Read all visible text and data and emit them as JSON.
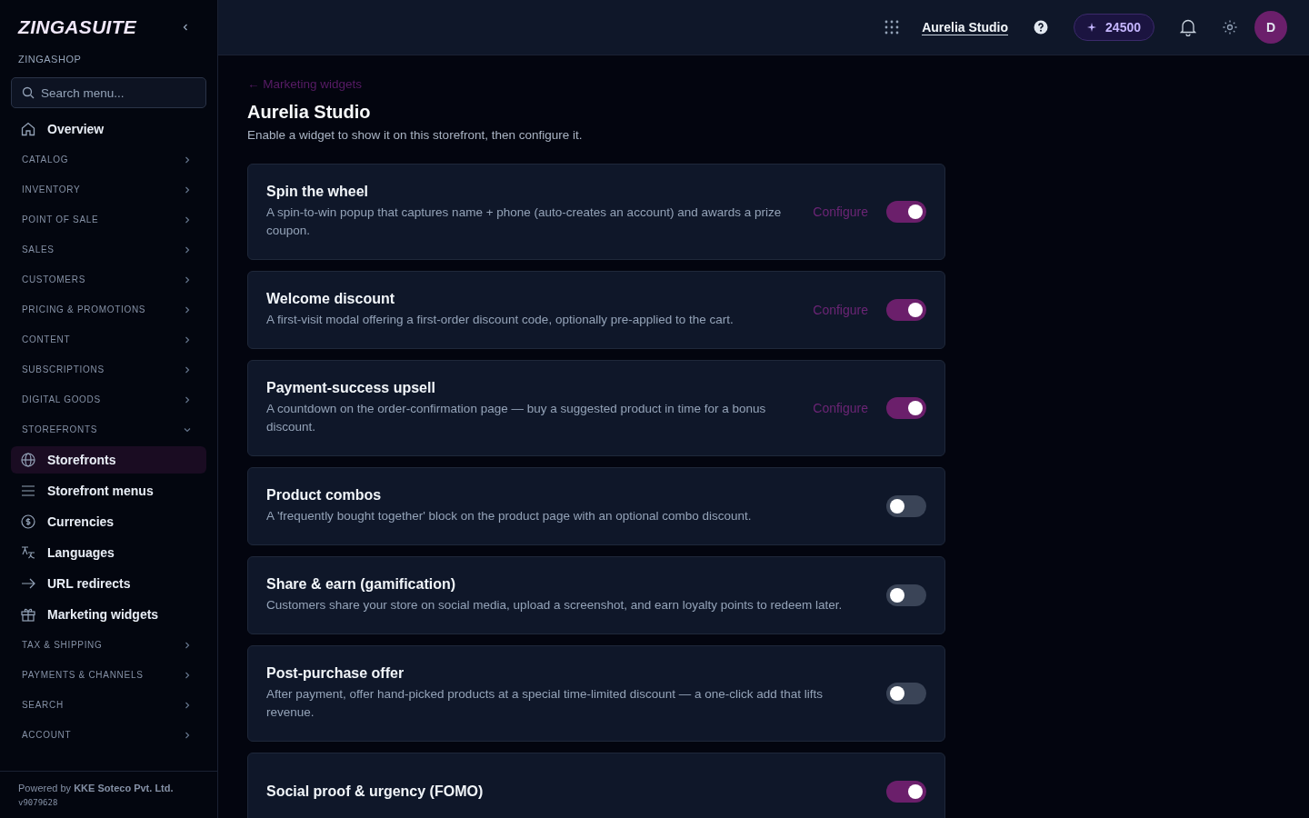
{
  "sidebar": {
    "logo": "ZINGASUITE",
    "workspace": "ZINGASHOP",
    "search": {
      "placeholder": "Search menu..."
    },
    "overview": {
      "label": "Overview",
      "selected": false
    },
    "groups": [
      {
        "label": "CATALOG",
        "expanded": false
      },
      {
        "label": "INVENTORY",
        "expanded": false
      },
      {
        "label": "POINT OF SALE",
        "expanded": false
      },
      {
        "label": "SALES",
        "expanded": false
      },
      {
        "label": "CUSTOMERS",
        "expanded": false
      },
      {
        "label": "PRICING & PROMOTIONS",
        "expanded": false
      },
      {
        "label": "CONTENT",
        "expanded": false
      },
      {
        "label": "SUBSCRIPTIONS",
        "expanded": false
      },
      {
        "label": "DIGITAL GOODS",
        "expanded": false
      },
      {
        "label": "STOREFRONTS",
        "expanded": true,
        "children": [
          {
            "label": "Storefronts",
            "selected": true
          },
          {
            "label": "Storefront menus",
            "selected": false
          },
          {
            "label": "Currencies",
            "selected": false
          },
          {
            "label": "Languages",
            "selected": false
          },
          {
            "label": "URL redirects",
            "selected": false
          },
          {
            "label": "Marketing widgets",
            "selected": false
          }
        ]
      },
      {
        "label": "TAX & SHIPPING",
        "expanded": false
      },
      {
        "label": "PAYMENTS & CHANNELS",
        "expanded": false
      },
      {
        "label": "SEARCH",
        "expanded": false
      },
      {
        "label": "ACCOUNT",
        "expanded": false
      }
    ],
    "footer": {
      "text": "Powered by **KKE Soteco Pvt. Ltd.**",
      "version": "v9079628"
    }
  },
  "topbar": {
    "store": "Aurelia Studio",
    "credits": "24500",
    "avatar": "D"
  },
  "page": {
    "back": "← Marketing widgets",
    "title": "Aurelia Studio",
    "subtitle": "Enable a widget to show it on this storefront, then configure it.",
    "widgets": [
      {
        "name": "Spin the wheel",
        "description": "A spin-to-win popup that captures name + phone (auto-creates an account) and awards a prize coupon.",
        "on": true,
        "action": "Configure"
      },
      {
        "name": "Welcome discount",
        "description": "A first-visit modal offering a first-order discount code, optionally pre-applied to the cart.",
        "on": true,
        "action": "Configure"
      },
      {
        "name": "Payment-success upsell",
        "description": "A countdown on the order-confirmation page — buy a suggested product in time for a bonus discount.",
        "on": true,
        "action": "Configure"
      },
      {
        "name": "Product combos",
        "description": "A 'frequently bought together' block on the product page with an optional combo discount.",
        "on": false
      },
      {
        "name": "Share & earn (gamification)",
        "description": "Customers share your store on social media, upload a screenshot, and earn loyalty points to redeem later.",
        "on": false
      },
      {
        "name": "Post-purchase offer",
        "description": "After payment, offer hand-picked products at a special time-limited discount — a one-click add that lifts revenue.",
        "on": false
      },
      {
        "name": "Social proof & urgency (FOMO)",
        "on": true
      }
    ]
  }
}
